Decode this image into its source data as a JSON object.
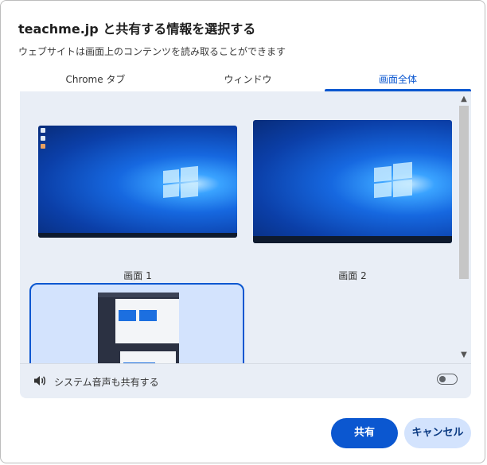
{
  "dialog": {
    "title": "teachme.jp と共有する情報を選択する",
    "subtitle": "ウェブサイトは画面上のコンテンツを読み取ることができます"
  },
  "tabs": [
    {
      "label": "Chrome タブ",
      "active": false
    },
    {
      "label": "ウィンドウ",
      "active": false
    },
    {
      "label": "画面全体",
      "active": true
    }
  ],
  "screens": [
    {
      "label": "画面 1",
      "selected": false
    },
    {
      "label": "画面 2",
      "selected": false
    }
  ],
  "audio": {
    "label": "システム音声も共有する",
    "enabled": false
  },
  "buttons": {
    "share": "共有",
    "cancel": "キャンセル"
  },
  "colors": {
    "accent": "#0b57d0",
    "selected_bg": "#d3e3fd",
    "panel_bg": "#e9eef6"
  }
}
